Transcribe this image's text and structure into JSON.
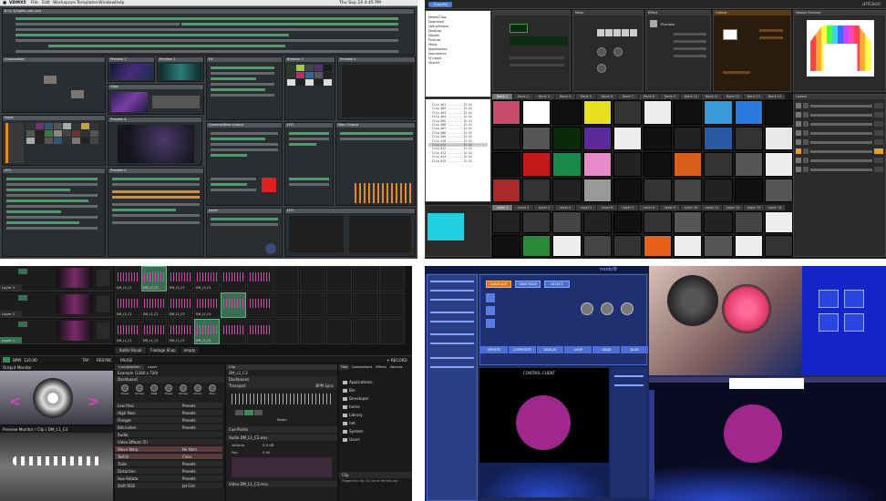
{
  "q1": {
    "menubar": {
      "items": [
        "VDMX5",
        "File",
        "Edit",
        "Workspace",
        "Templates",
        "Window",
        "Help"
      ],
      "clock": "Thu Sep 24  4:45 PM"
    },
    "title": "8 CL 5|Lights_last_last",
    "panels": {
      "composition": "Composition",
      "preview1": "Preview 1",
      "preview2": "Preview 2",
      "preview3": "Preview 3",
      "preview4": "Preview 4",
      "clips": "Clips",
      "browser": "Browser 1",
      "lfo": "LFO",
      "fx": "FX",
      "mixer": "Camera/Mask Output",
      "layer": "Layer",
      "main_output": "Main Output"
    }
  },
  "q2": {
    "title": "GrandVJ",
    "brand": "arkaos",
    "sections": {
      "mixer": "Mixer",
      "effect": "Effect",
      "master": "Master Preview",
      "output": "Output",
      "layers": "Layers"
    },
    "effect_name": "Pixelate",
    "file_list": [
      "Media/Clips",
      "Download",
      "Users/Arkaos",
      "Desktop",
      "Movies",
      "Pictures",
      "Music",
      "Applications",
      "Documents",
      "VJ Loops",
      "Shared"
    ],
    "bank_tabs": [
      "Bank 1",
      "Bank 2",
      "Bank 3",
      "Bank 4",
      "Bank 5",
      "Bank 6",
      "Bank 7",
      "Bank 8",
      "Bank 9",
      "Bank 10",
      "Bank 11",
      "Bank 12",
      "Bank 13",
      "Bank 14",
      "Bank 15"
    ],
    "layer_tabs": [
      "Layer 1",
      "Layer 2",
      "Layer 3",
      "Layer 4",
      "Layer 5",
      "Layer 6",
      "Layer 7",
      "Layer 8",
      "Layer 9",
      "Layer 10",
      "Layer 11",
      "Layer 12",
      "Layer 13",
      "Layer 14",
      "Layer 15"
    ],
    "logo_text": "interactivity"
  },
  "q3": {
    "clip_labels": [
      "DM_L3_C1",
      "DM_L3_C2",
      "DM_L3_C3",
      "DM_L3_C4",
      "DM_L2_C1",
      "DM_L2_C2",
      "DM_L2_C3",
      "DM_L2_C4",
      "DM_L1_C1",
      "DM_L1_C2",
      "DM_L1_C3",
      "DM_L1_C4"
    ],
    "layer_labels": [
      "Layer 3",
      "Layer 2",
      "Layer 1"
    ],
    "deck_tabs": [
      "Audio Visual",
      "Footage Shop",
      "empty"
    ],
    "transport": {
      "bpm_label": "BPM",
      "bpm": "120.00",
      "tap": "TAP",
      "resync": "RESYNC",
      "pause": "PAUSE",
      "record": "+ RECORD"
    },
    "output_monitor": "Output Monitor",
    "preview_monitor": "Preview Monitor / Clip / DM_L1_C3",
    "comp_tabs": [
      "Composition",
      "Layer",
      "Clip"
    ],
    "example": "Example (1280 x 720)",
    "dashboard": "Dashboard",
    "knobs": [
      "Pixels",
      "Stroke",
      "RGB",
      "Pixels",
      "Stroke",
      "Zoom",
      "Blur"
    ],
    "fx_rows": [
      {
        "name": "Low Pass",
        "value": "Presets"
      },
      {
        "name": "High Pass",
        "value": "Presets"
      },
      {
        "name": "Flanger",
        "value": "Presets"
      },
      {
        "name": "Bitcrusher",
        "value": "Presets"
      },
      {
        "name": "Audio",
        "value": ""
      },
      {
        "name": "Video Effects (5)",
        "value": ""
      },
      {
        "name": "Wave Warp",
        "value": "No Nam"
      },
      {
        "name": "Twitch",
        "value": "Class"
      },
      {
        "name": "Trails",
        "value": "Presets"
      },
      {
        "name": "Distortion",
        "value": "Presets"
      },
      {
        "name": "Hue Rotate",
        "value": "Presets"
      },
      {
        "name": "Shift RGB",
        "value": "Jet Grit"
      }
    ],
    "clip_panel": {
      "clip_name": "DM_L1_C3",
      "transport": "Transport",
      "bpm_sync": "BPM Sync",
      "beats": "Beats",
      "cue_points": "Cue Points",
      "audio": "Audio  DM_L1_C3.wav",
      "volume": "Volume",
      "vol_value": "0.0 dB",
      "pan": "Pan",
      "pan_value": "0.00",
      "video": "Video  DM_L1_C3.mov"
    },
    "file_tabs": [
      "Files",
      "Compositions",
      "Effects",
      "Sources"
    ],
    "files": [
      "Applications",
      "Bin",
      "Developer",
      "home",
      "Library",
      "net",
      "System",
      "Users"
    ],
    "clip_hint": "Clip",
    "clip_hint_text": "Trigger this clip. Go live or fire this clip"
  },
  "q4": {
    "title": "modul8",
    "buttons": [
      "LOAD CLIP",
      "SAVE PAGE",
      "SELECT",
      "CONTINUE",
      "RESET",
      "STOP"
    ],
    "tabs": [
      "SPRITES",
      "COMPOSITE",
      "DISPLAY",
      "LOOP",
      "GRAB",
      "BLUR"
    ],
    "section": "CONTROL CLIENT"
  }
}
